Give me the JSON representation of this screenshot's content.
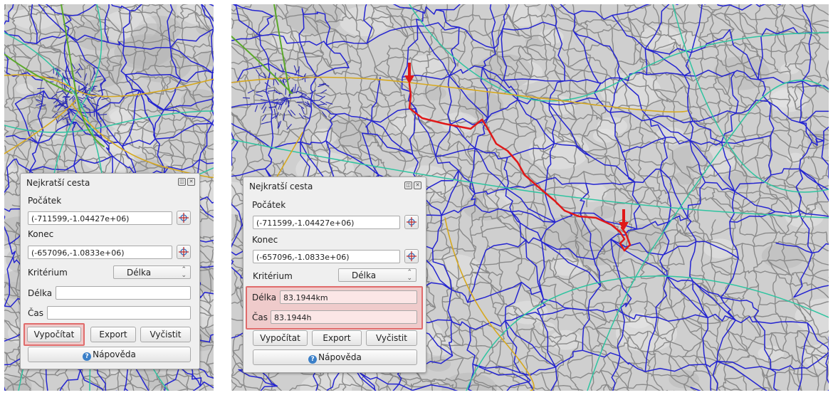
{
  "dialog_left": {
    "title": "Nejkratší cesta",
    "start_label": "Počátek",
    "start_value": "(-711599,-1.04427e+06)",
    "end_label": "Konec",
    "end_value": "(-657096,-1.0833e+06)",
    "criterion_label": "Kritérium",
    "criterion_value": "Délka",
    "length_label": "Délka",
    "length_value": "",
    "time_label": "Čas",
    "time_value": "",
    "calculate_label": "Vypočítat",
    "export_label": "Export",
    "clear_label": "Vyčistit",
    "help_label": "Nápověda"
  },
  "dialog_right": {
    "title": "Nejkratší cesta",
    "start_label": "Počátek",
    "start_value": "(-711599,-1.04427e+06)",
    "end_label": "Konec",
    "end_value": "(-657096,-1.0833e+06)",
    "criterion_label": "Kritérium",
    "criterion_value": "Délka",
    "length_label": "Délka",
    "length_value": "83.1944km",
    "time_label": "Čas",
    "time_value": "83.1944h",
    "calculate_label": "Vypočítat",
    "export_label": "Export",
    "clear_label": "Vyčistit",
    "help_label": "Nápověda"
  },
  "colors": {
    "hillshade": "#cfcfcf",
    "road_minor": "#8a8a8a",
    "road_regional": "#2424d0",
    "road_primary": "#2ec4a0",
    "road_trunk": "#d6a81e",
    "road_highway": "#5aa82a",
    "route": "#e01818",
    "marker_arrow": "#e01818",
    "highlight": "#e06b6b"
  },
  "icons": {
    "pick_point": "crosshair-icon",
    "help": "question-circle-icon",
    "float_window": "float-icon",
    "close_window": "close-icon"
  }
}
